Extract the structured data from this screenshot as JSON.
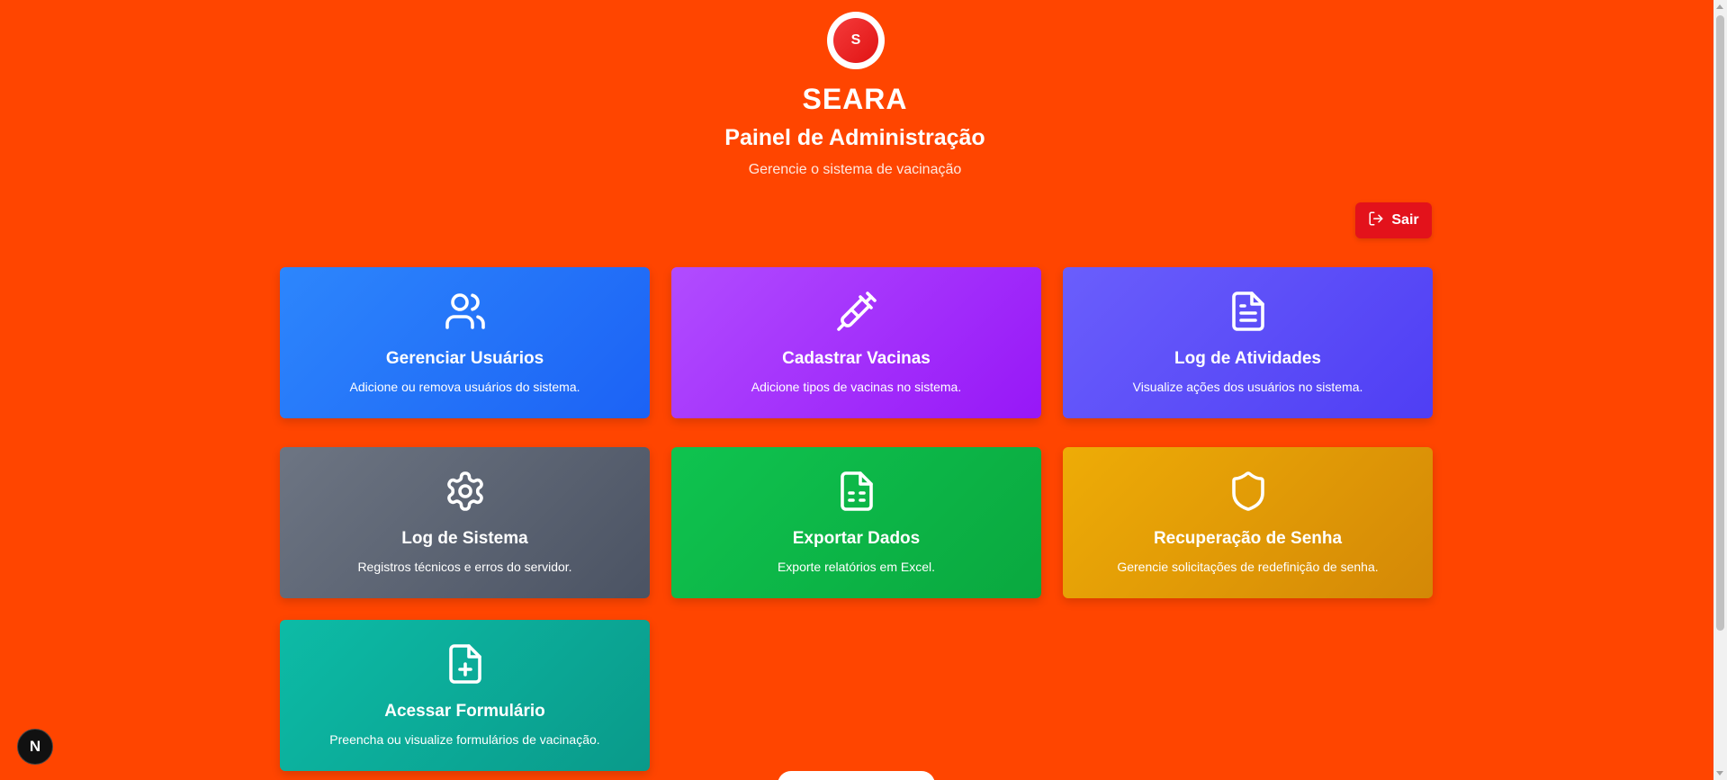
{
  "header": {
    "logo_letter": "S",
    "brand": "SEARA",
    "title": "Painel de Administração",
    "subtitle": "Gerencie o sistema de vacinação"
  },
  "logout": {
    "label": "Sair",
    "icon": "log-out-icon",
    "color": "#e3121b"
  },
  "cards": [
    {
      "title": "Gerenciar Usuários",
      "description": "Adicione ou remova usuários do sistema.",
      "icon": "users-icon",
      "color": "#1c62f5"
    },
    {
      "title": "Cadastrar Vacinas",
      "description": "Adicione tipos de vacinas no sistema.",
      "icon": "syringe-icon",
      "color": "#9717f7"
    },
    {
      "title": "Log de Atividades",
      "description": "Visualize ações dos usuários no sistema.",
      "icon": "file-text-icon",
      "color": "#4f3ef4"
    },
    {
      "title": "Log de Sistema",
      "description": "Registros técnicos e erros do servidor.",
      "icon": "gear-icon",
      "color": "#4b5363"
    },
    {
      "title": "Exportar Dados",
      "description": "Exporte relatórios em Excel.",
      "icon": "file-spreadsheet-icon",
      "color": "#0aa83f"
    },
    {
      "title": "Recuperação de Senha",
      "description": "Gerencie solicitações de redefinição de senha.",
      "icon": "shield-icon",
      "color": "#d48806"
    },
    {
      "title": "Acessar Formulário",
      "description": "Preencha ou visualize formulários de vacinação.",
      "icon": "file-plus-icon",
      "color": "#0a9a8a"
    }
  ],
  "floating_badge": {
    "label": "N"
  },
  "colors": {
    "background": "#ff4500"
  }
}
